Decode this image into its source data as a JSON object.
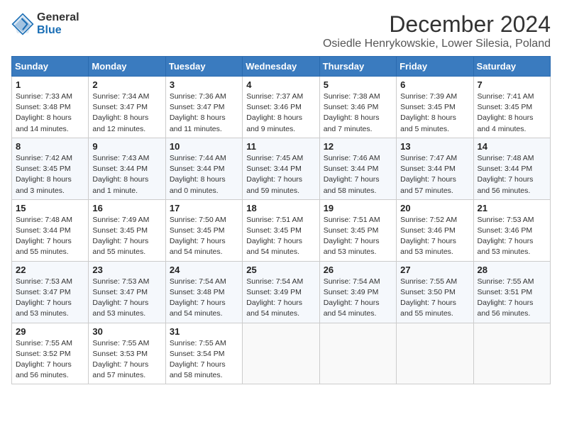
{
  "header": {
    "logo_line1": "General",
    "logo_line2": "Blue",
    "title": "December 2024",
    "subtitle": "Osiedle Henrykowskie, Lower Silesia, Poland"
  },
  "calendar": {
    "weekdays": [
      "Sunday",
      "Monday",
      "Tuesday",
      "Wednesday",
      "Thursday",
      "Friday",
      "Saturday"
    ],
    "weeks": [
      [
        {
          "day": "1",
          "info": "Sunrise: 7:33 AM\nSunset: 3:48 PM\nDaylight: 8 hours\nand 14 minutes."
        },
        {
          "day": "2",
          "info": "Sunrise: 7:34 AM\nSunset: 3:47 PM\nDaylight: 8 hours\nand 12 minutes."
        },
        {
          "day": "3",
          "info": "Sunrise: 7:36 AM\nSunset: 3:47 PM\nDaylight: 8 hours\nand 11 minutes."
        },
        {
          "day": "4",
          "info": "Sunrise: 7:37 AM\nSunset: 3:46 PM\nDaylight: 8 hours\nand 9 minutes."
        },
        {
          "day": "5",
          "info": "Sunrise: 7:38 AM\nSunset: 3:46 PM\nDaylight: 8 hours\nand 7 minutes."
        },
        {
          "day": "6",
          "info": "Sunrise: 7:39 AM\nSunset: 3:45 PM\nDaylight: 8 hours\nand 5 minutes."
        },
        {
          "day": "7",
          "info": "Sunrise: 7:41 AM\nSunset: 3:45 PM\nDaylight: 8 hours\nand 4 minutes."
        }
      ],
      [
        {
          "day": "8",
          "info": "Sunrise: 7:42 AM\nSunset: 3:45 PM\nDaylight: 8 hours\nand 3 minutes."
        },
        {
          "day": "9",
          "info": "Sunrise: 7:43 AM\nSunset: 3:44 PM\nDaylight: 8 hours\nand 1 minute."
        },
        {
          "day": "10",
          "info": "Sunrise: 7:44 AM\nSunset: 3:44 PM\nDaylight: 8 hours\nand 0 minutes."
        },
        {
          "day": "11",
          "info": "Sunrise: 7:45 AM\nSunset: 3:44 PM\nDaylight: 7 hours\nand 59 minutes."
        },
        {
          "day": "12",
          "info": "Sunrise: 7:46 AM\nSunset: 3:44 PM\nDaylight: 7 hours\nand 58 minutes."
        },
        {
          "day": "13",
          "info": "Sunrise: 7:47 AM\nSunset: 3:44 PM\nDaylight: 7 hours\nand 57 minutes."
        },
        {
          "day": "14",
          "info": "Sunrise: 7:48 AM\nSunset: 3:44 PM\nDaylight: 7 hours\nand 56 minutes."
        }
      ],
      [
        {
          "day": "15",
          "info": "Sunrise: 7:48 AM\nSunset: 3:44 PM\nDaylight: 7 hours\nand 55 minutes."
        },
        {
          "day": "16",
          "info": "Sunrise: 7:49 AM\nSunset: 3:45 PM\nDaylight: 7 hours\nand 55 minutes."
        },
        {
          "day": "17",
          "info": "Sunrise: 7:50 AM\nSunset: 3:45 PM\nDaylight: 7 hours\nand 54 minutes."
        },
        {
          "day": "18",
          "info": "Sunrise: 7:51 AM\nSunset: 3:45 PM\nDaylight: 7 hours\nand 54 minutes."
        },
        {
          "day": "19",
          "info": "Sunrise: 7:51 AM\nSunset: 3:45 PM\nDaylight: 7 hours\nand 53 minutes."
        },
        {
          "day": "20",
          "info": "Sunrise: 7:52 AM\nSunset: 3:46 PM\nDaylight: 7 hours\nand 53 minutes."
        },
        {
          "day": "21",
          "info": "Sunrise: 7:53 AM\nSunset: 3:46 PM\nDaylight: 7 hours\nand 53 minutes."
        }
      ],
      [
        {
          "day": "22",
          "info": "Sunrise: 7:53 AM\nSunset: 3:47 PM\nDaylight: 7 hours\nand 53 minutes."
        },
        {
          "day": "23",
          "info": "Sunrise: 7:53 AM\nSunset: 3:47 PM\nDaylight: 7 hours\nand 53 minutes."
        },
        {
          "day": "24",
          "info": "Sunrise: 7:54 AM\nSunset: 3:48 PM\nDaylight: 7 hours\nand 54 minutes."
        },
        {
          "day": "25",
          "info": "Sunrise: 7:54 AM\nSunset: 3:49 PM\nDaylight: 7 hours\nand 54 minutes."
        },
        {
          "day": "26",
          "info": "Sunrise: 7:54 AM\nSunset: 3:49 PM\nDaylight: 7 hours\nand 54 minutes."
        },
        {
          "day": "27",
          "info": "Sunrise: 7:55 AM\nSunset: 3:50 PM\nDaylight: 7 hours\nand 55 minutes."
        },
        {
          "day": "28",
          "info": "Sunrise: 7:55 AM\nSunset: 3:51 PM\nDaylight: 7 hours\nand 56 minutes."
        }
      ],
      [
        {
          "day": "29",
          "info": "Sunrise: 7:55 AM\nSunset: 3:52 PM\nDaylight: 7 hours\nand 56 minutes."
        },
        {
          "day": "30",
          "info": "Sunrise: 7:55 AM\nSunset: 3:53 PM\nDaylight: 7 hours\nand 57 minutes."
        },
        {
          "day": "31",
          "info": "Sunrise: 7:55 AM\nSunset: 3:54 PM\nDaylight: 7 hours\nand 58 minutes."
        },
        {
          "day": "",
          "info": ""
        },
        {
          "day": "",
          "info": ""
        },
        {
          "day": "",
          "info": ""
        },
        {
          "day": "",
          "info": ""
        }
      ]
    ]
  }
}
